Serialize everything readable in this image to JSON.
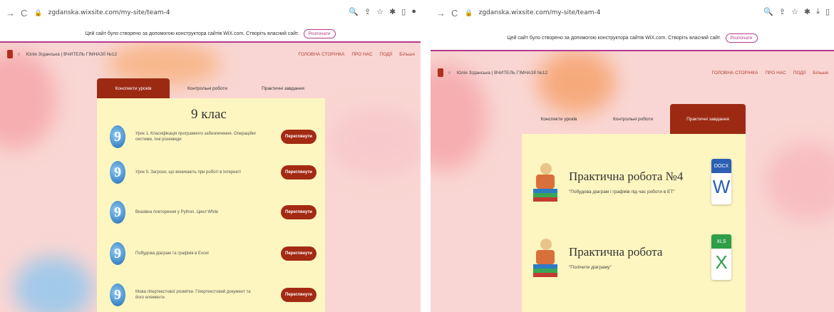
{
  "left": {
    "url": "zgdanska.wixsite.com/my-site/team-4",
    "banner": {
      "text": "Цей сайт було створено за допомогою конструктора сайтів WiX.com. Створіть власний сайт.",
      "button": "Розпочати"
    },
    "site_name": "Юлія Згданська | ВЧИТЕЛЬ ГІМНАЗІЇ №12",
    "nav": [
      "ГОЛОВНА СТОРІНКА",
      "ПРО НАС",
      "ПОДІЇ",
      "Більше"
    ],
    "tabs": [
      "Конспекти уроків",
      "Контрольні роботи",
      "Практичні завдання"
    ],
    "active_tab": 0,
    "class_title": "9 клас",
    "badge": "9",
    "lessons": [
      {
        "text": "Урок 1. Класифікація програмного забезпечення. Операційні системи, їхні різновиди",
        "button": "Переглянути"
      },
      {
        "text": "Урок 5. Загрози, що виникають при роботі в Інтернеті",
        "button": "Переглянути"
      },
      {
        "text": "Вказівка повторення у Python. Цикл While",
        "button": "Переглянути"
      },
      {
        "text": "Побудова діаграм та графіків в Excel",
        "button": "Переглянути"
      },
      {
        "text": "Мова гіпертекстової розмітки. Гіпертекстовий документ та його елементи.",
        "button": "Переглянути"
      }
    ]
  },
  "right": {
    "url": "zgdanska.wixsite.com/my-site/team-4",
    "banner": {
      "text": "Цей сайт було створено за допомогою конструктора сайтів WiX.com. Створіть власний сайт.",
      "button": "Розпочати"
    },
    "site_name": "Юлія Згданська | ВЧИТЕЛЬ ГІМНАЗІЇ №12",
    "nav": [
      "ГОЛОВНА СТОРІНКА",
      "ПРО НАС",
      "ПОДІЇ",
      "Більше"
    ],
    "tabs": [
      "Конспекти уроків",
      "Контрольні роботи",
      "Практичні завдання"
    ],
    "active_tab": 2,
    "practicals": [
      {
        "title": "Практична робота №4",
        "subtitle": "\"Побудова діаграм і графіків під час роботи в ЕТ\"",
        "file_type": "DOCX",
        "file_letter": "W",
        "color": "#2b5fb4"
      },
      {
        "title": "Практична робота",
        "subtitle": "\"Полічити діаграму\"",
        "file_type": "XLS",
        "file_letter": "X",
        "color": "#2e9e48"
      }
    ]
  },
  "colors": {
    "accent": "#a32a13",
    "card": "#fdf6c0",
    "background": "#f9d6d3",
    "wix_pink": "#b33a8e"
  }
}
